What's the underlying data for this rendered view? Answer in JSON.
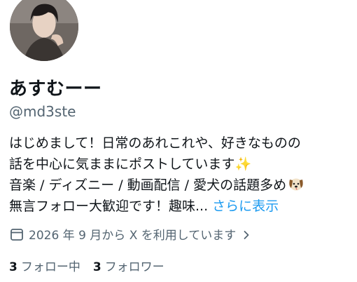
{
  "profile": {
    "display_name": "あすむーー",
    "handle": "@md3ste",
    "bio": {
      "line1": "はじめまして！日常のあれこれや、好きなものの",
      "line2": "話を中心に気ままにポストしています",
      "line2_emoji": "✨",
      "line3": "音楽 / ディズニー / 動画配信 / 愛犬の話題多め",
      "line3_emoji": "dog-face-icon",
      "line4": "無言フォロー大歓迎です！趣味...",
      "more_label": "さらに表示"
    },
    "joined": {
      "icon": "calendar-icon",
      "text": "2026 年 9 月から X を利用しています",
      "chevron": "chevron-right-icon"
    },
    "following": {
      "count": "3",
      "label": "フォロー中"
    },
    "followers": {
      "count": "3",
      "label": "フォロワー"
    }
  },
  "colors": {
    "text_primary": "#0f1419",
    "text_secondary": "#536471",
    "link": "#1d9bf0"
  }
}
